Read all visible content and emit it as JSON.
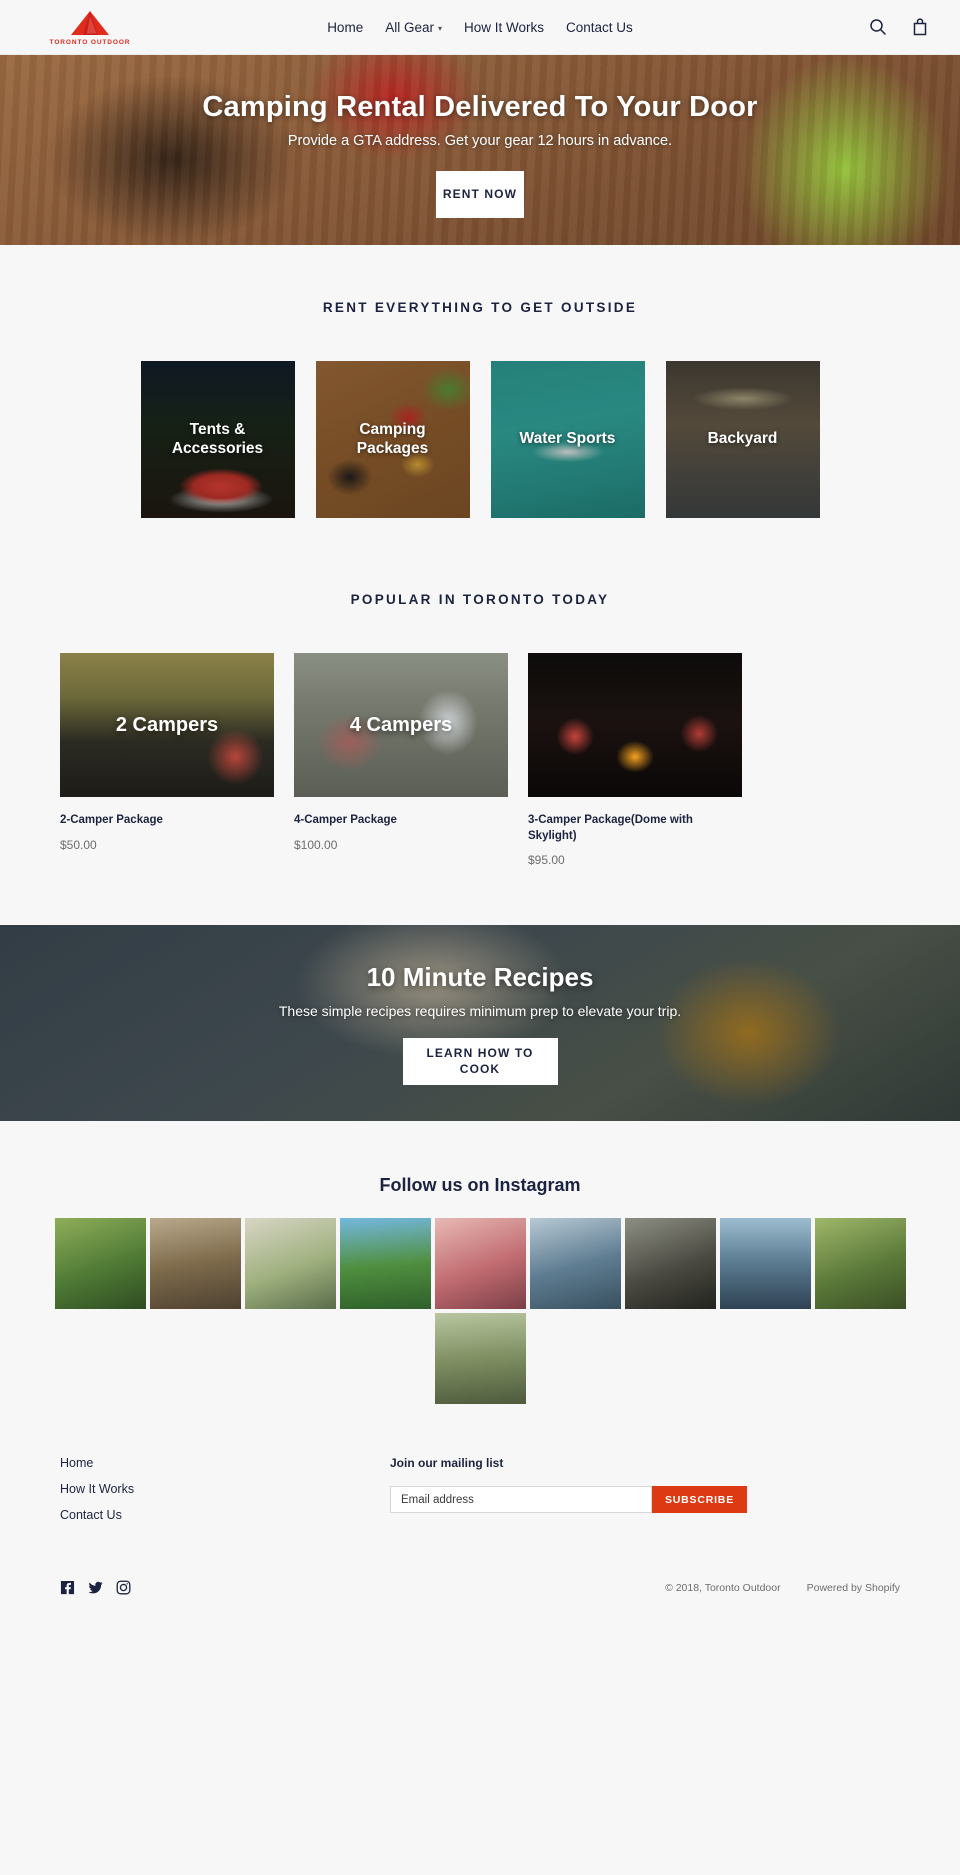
{
  "header": {
    "logo": {
      "icon": "tent-icon",
      "text": "TORONTO OUTDOOR",
      "color": "#e02b1d"
    },
    "nav": [
      {
        "label": "Home",
        "has_caret": false
      },
      {
        "label": "All Gear",
        "has_caret": true
      },
      {
        "label": "How It Works",
        "has_caret": false
      },
      {
        "label": "Contact Us",
        "has_caret": false
      }
    ],
    "icons": [
      {
        "name": "search-icon"
      },
      {
        "name": "cart-icon"
      }
    ]
  },
  "hero": {
    "title": "Camping Rental Delivered To Your Door",
    "subtitle": "Provide a GTA address. Get your gear 12 hours in advance.",
    "button": "RENT NOW"
  },
  "categories": {
    "heading": "RENT EVERYTHING TO GET OUTSIDE",
    "items": [
      {
        "label": "Tents & Accessories"
      },
      {
        "label": "Camping Packages"
      },
      {
        "label": "Water Sports"
      },
      {
        "label": "Backyard"
      }
    ]
  },
  "popular": {
    "heading": "POPULAR IN TORONTO TODAY",
    "products": [
      {
        "overlay": "2 Campers",
        "title": "2-Camper Package",
        "price": "$50.00"
      },
      {
        "overlay": "4 Campers",
        "title": "4-Camper Package",
        "price": "$100.00"
      },
      {
        "overlay": "",
        "title": "3-Camper Package(Dome with Skylight)",
        "price": "$95.00"
      }
    ]
  },
  "recipes": {
    "title": "10 Minute Recipes",
    "subtitle": "These simple recipes requires minimum prep to elevate your trip.",
    "button": "LEARN HOW TO COOK"
  },
  "instagram": {
    "heading": "Follow us on Instagram",
    "count": 10
  },
  "footer": {
    "links": [
      {
        "label": "Home"
      },
      {
        "label": "How It Works"
      },
      {
        "label": "Contact Us"
      }
    ],
    "newsletter": {
      "title": "Join our mailing list",
      "placeholder": "Email address",
      "value": "",
      "button": "SUBSCRIBE",
      "button_color": "#dd3a13"
    },
    "socials": [
      {
        "name": "facebook-icon"
      },
      {
        "name": "twitter-icon"
      },
      {
        "name": "instagram-icon"
      }
    ],
    "copyright": "© 2018, Toronto Outdoor",
    "powered_by": "Powered by Shopify"
  }
}
